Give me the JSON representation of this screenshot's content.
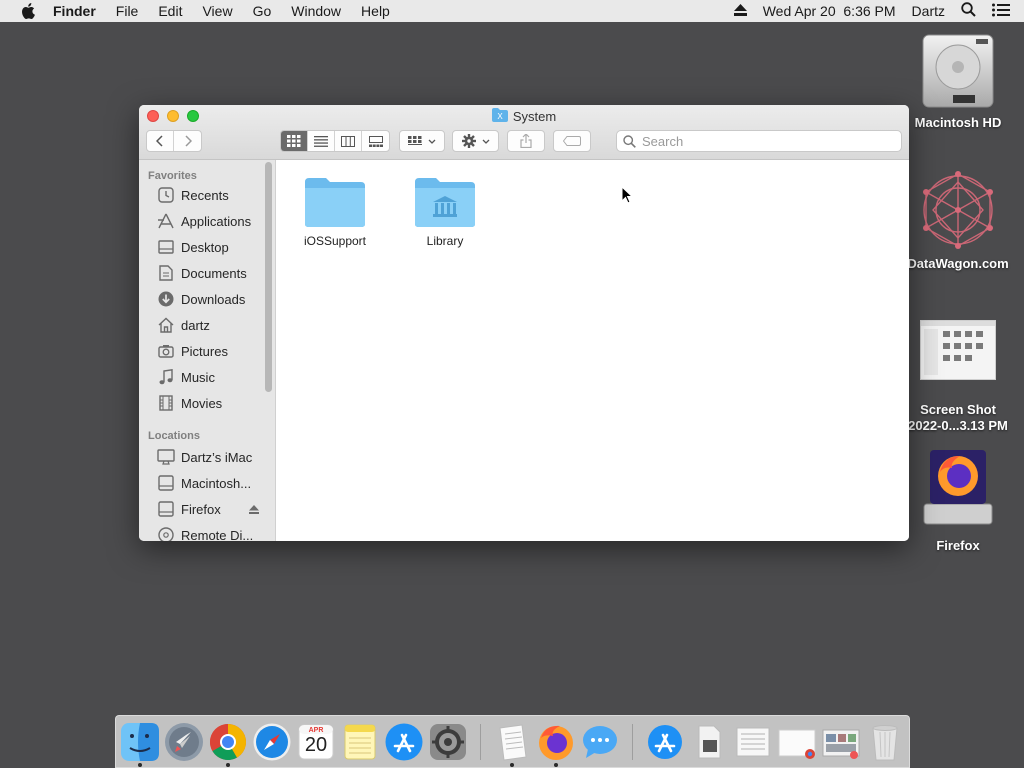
{
  "menubar": {
    "app_name": "Finder",
    "items": [
      "File",
      "Edit",
      "View",
      "Go",
      "Window",
      "Help"
    ],
    "datetime": "Wed Apr 20  6:36 PM",
    "user": "Dartz"
  },
  "desktop": {
    "icons": [
      {
        "label": "Macintosh HD",
        "icon": "hard-drive-icon"
      },
      {
        "label": "DataWagon.com",
        "icon": "datawagon-icon"
      },
      {
        "label_line1": "Screen Shot",
        "label_line2": "2022-0...3.13 PM",
        "icon": "screenshot-thumbnail-icon"
      },
      {
        "label": "Firefox",
        "icon": "firefox-volume-icon"
      }
    ]
  },
  "window": {
    "title": "System",
    "search_placeholder": "Search",
    "sidebar": {
      "favorites_header": "Favorites",
      "favorites": [
        {
          "label": "Recents",
          "icon": "clock-icon"
        },
        {
          "label": "Applications",
          "icon": "applications-icon"
        },
        {
          "label": "Desktop",
          "icon": "desktop-icon"
        },
        {
          "label": "Documents",
          "icon": "document-icon"
        },
        {
          "label": "Downloads",
          "icon": "download-icon"
        },
        {
          "label": "dartz",
          "icon": "home-icon"
        },
        {
          "label": "Pictures",
          "icon": "camera-icon"
        },
        {
          "label": "Music",
          "icon": "music-note-icon"
        },
        {
          "label": "Movies",
          "icon": "film-icon"
        }
      ],
      "locations_header": "Locations",
      "locations": [
        {
          "label": "Dartz’s iMac",
          "icon": "imac-icon"
        },
        {
          "label": "Macintosh...",
          "icon": "drive-icon"
        },
        {
          "label": "Firefox",
          "icon": "drive-icon"
        },
        {
          "label": "Remote Di...",
          "icon": "disc-icon"
        }
      ]
    },
    "items": [
      {
        "label": "iOSSupport",
        "icon": "folder-icon"
      },
      {
        "label": "Library",
        "icon": "library-folder-icon"
      }
    ]
  },
  "dock": {
    "apps": [
      "Finder",
      "Launchpad",
      "Chrome",
      "Safari",
      "Calendar",
      "Notes",
      "App Store",
      "System Preferences",
      "TextEdit",
      "Firefox",
      "Messages",
      "App Store Downloads",
      "Preview",
      "Documents",
      "Screenshot",
      "Screenshots",
      "Trash"
    ],
    "calendar_month": "APR",
    "calendar_day": "20"
  }
}
